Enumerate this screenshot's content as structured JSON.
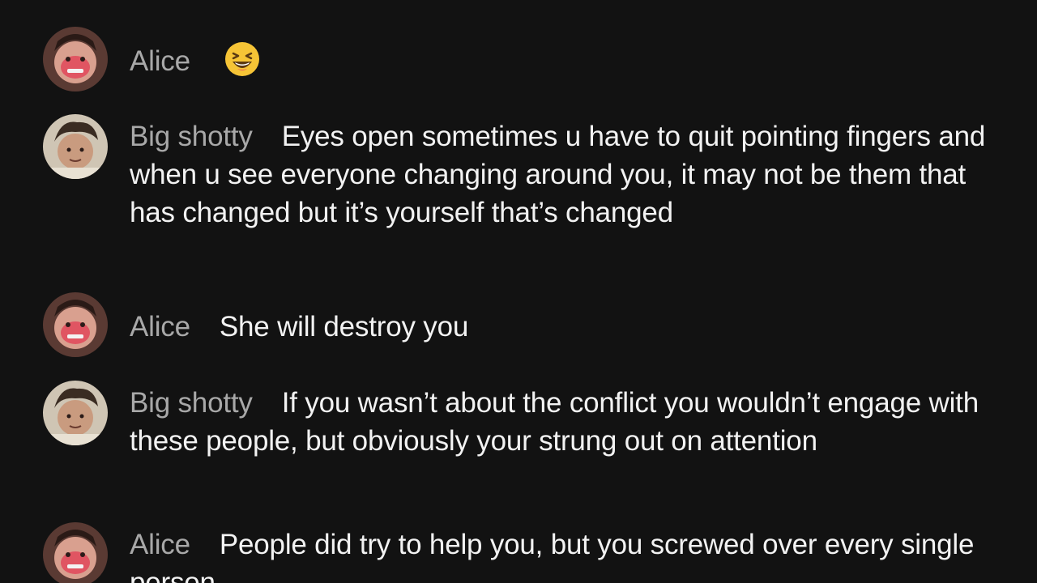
{
  "comments": [
    {
      "author": "Alice",
      "text": "",
      "emoji": "grinning-squinting-face-emoji",
      "avatar": "alice"
    },
    {
      "author": "Big shotty",
      "text": "Eyes open sometimes u have to quit pointing fingers and when u see everyone changing around you, it may not be them that has changed but it’s yourself that’s changed",
      "avatar": "big-shotty"
    },
    {
      "author": "Alice",
      "text": "She will destroy you",
      "avatar": "alice"
    },
    {
      "author": "Big shotty",
      "text": "If you wasn’t about the conflict you wouldn’t engage with these people, but obviously your strung out on attention",
      "avatar": "big-shotty"
    },
    {
      "author": "Alice",
      "text": "People did try to help you, but you screwed over every single person",
      "avatar": "alice"
    }
  ],
  "colors": {
    "background": "#121212",
    "username": "#a8a8a8",
    "text": "#f2f2f2"
  }
}
